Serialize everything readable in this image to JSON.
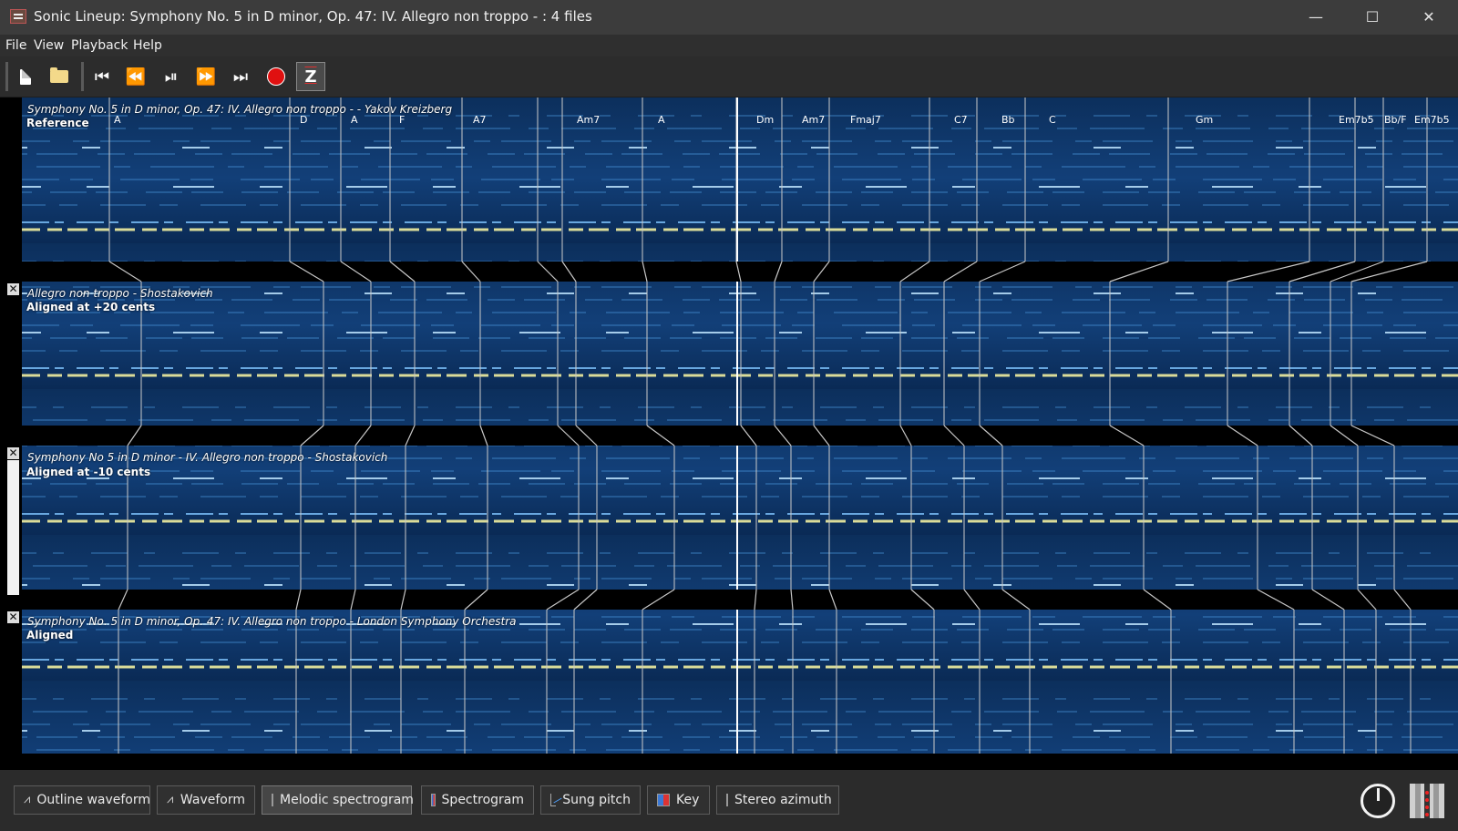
{
  "window": {
    "title": "Sonic Lineup: Symphony No. 5 in D minor, Op. 47: IV. Allegro non troppo - : 4 files",
    "minimize_glyph": "—",
    "maximize_glyph": "☐",
    "close_glyph": "✕"
  },
  "menu": [
    "File",
    "View",
    "Playback",
    "Help"
  ],
  "toolbar": {
    "items": [
      "new-file-icon",
      "open-folder-icon",
      "skip-to-start-icon",
      "rewind-icon",
      "play-pause-icon",
      "fast-forward-icon",
      "skip-to-end-icon",
      "record-icon",
      "zoom-align-icon"
    ],
    "glyphs": {
      "start": "⏮",
      "rewind": "⏪",
      "playpause": "⏯",
      "forward": "⏩",
      "end": "⏭",
      "zoom": "Z"
    }
  },
  "panes": [
    {
      "title": "Symphony No. 5 in D minor, Op. 47: IV. Allegro non troppo -  - Yakov Kreizberg",
      "subtitle": "Reference",
      "closable": false
    },
    {
      "title": "Allegro non troppo - Shostakovich",
      "subtitle": "Aligned at +20 cents",
      "closable": true
    },
    {
      "title": "Symphony No 5 in D minor - IV. Allegro non troppo - Shostakovich",
      "subtitle": "Aligned at -10 cents",
      "closable": true
    },
    {
      "title": "Symphony No. 5 in D minor, Op. 47: IV. Allegro non troppo - London Symphony Orchestra",
      "subtitle": "Aligned",
      "closable": true
    }
  ],
  "close_glyph": "✕",
  "chords": [
    "A",
    "D",
    "A",
    "F",
    "A7",
    "Am7",
    "A",
    "Dm",
    "Am7",
    "Fmaj7",
    "C7",
    "Bb",
    "C",
    "Gm",
    "Em7b5",
    "Bb/F",
    "Em7b5"
  ],
  "layers": [
    {
      "label": "Outline waveform",
      "icon": "outline-waveform-icon",
      "active": false
    },
    {
      "label": "Waveform",
      "icon": "waveform-icon",
      "active": false
    },
    {
      "label": "Melodic spectrogram",
      "icon": "melodic-spectrogram-icon",
      "active": true
    },
    {
      "label": "Spectrogram",
      "icon": "spectrogram-icon",
      "active": false
    },
    {
      "label": "Sung pitch",
      "icon": "sung-pitch-icon",
      "active": false
    },
    {
      "label": "Key",
      "icon": "key-icon",
      "active": false
    },
    {
      "label": "Stereo azimuth",
      "icon": "stereo-azimuth-icon",
      "active": false
    }
  ],
  "colors": {
    "spectrogram_bg": "#0b2a52",
    "spectrogram_mid": "#1a5fa8",
    "spectrogram_hot": "#f4f07a",
    "alignment_line": "#c8c8c8"
  }
}
